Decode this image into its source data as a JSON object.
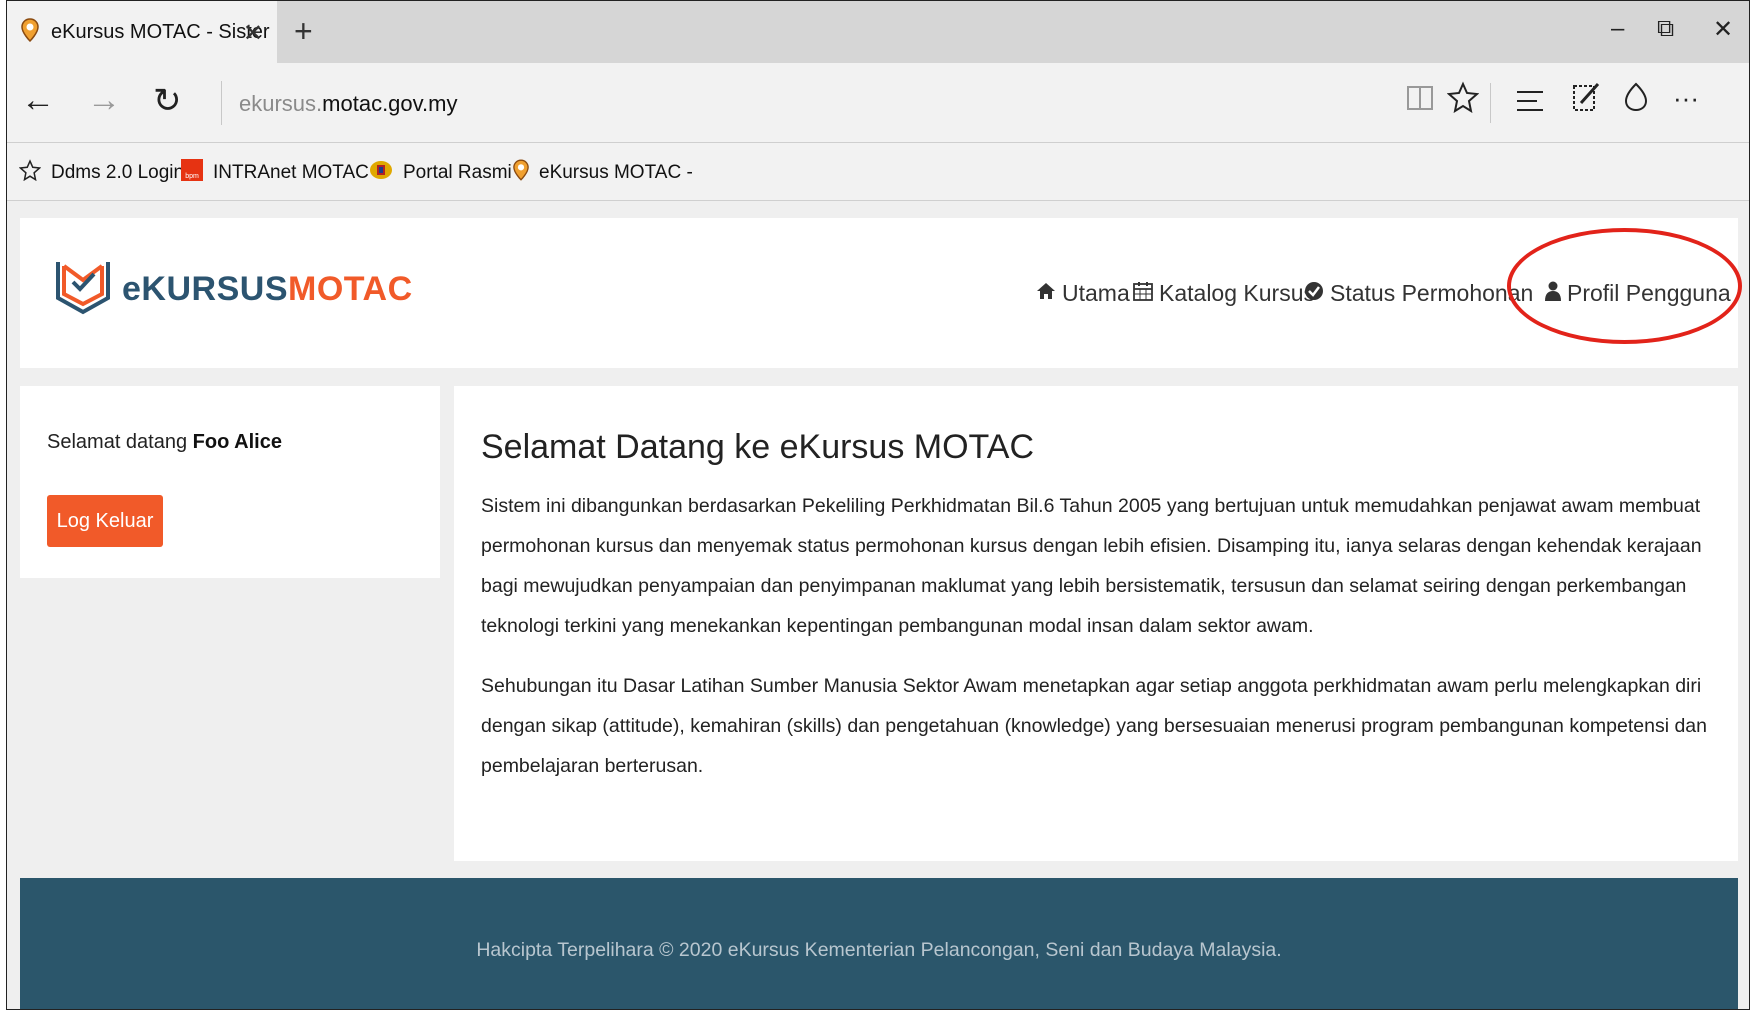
{
  "browser": {
    "tab_title": "eKursus MOTAC - Sister",
    "tab_close": "✕",
    "new_tab": "+",
    "window_controls": {
      "minimize": "–",
      "restore": "⧉",
      "close": "✕"
    },
    "nav": {
      "back": "←",
      "forward": "→",
      "refresh": "↻"
    },
    "url_subdomain": "ekursus.",
    "url_domain": "motac.gov.my",
    "toolbar_icons": [
      "reading-view-icon",
      "favorite-star-icon",
      "hub-icon",
      "web-note-icon",
      "share-icon",
      "more-icon"
    ],
    "more_label": "···",
    "favorites": [
      {
        "label": "Ddms 2.0 Login",
        "icon": "star-icon"
      },
      {
        "label": "INTRAnet MOTAC -",
        "icon": "bpm-icon"
      },
      {
        "label": "Portal Rasmi",
        "icon": "crest-icon"
      },
      {
        "label": "eKursus MOTAC -",
        "icon": "pin-icon"
      }
    ]
  },
  "site": {
    "logo": {
      "part1": "e",
      "part2": "KURSUS",
      "part3": "MOTAC"
    },
    "nav": [
      {
        "label": "Utama",
        "icon": "home-icon"
      },
      {
        "label": "Katalog Kursus",
        "icon": "calendar-icon"
      },
      {
        "label": "Status Permohonan",
        "icon": "check-circle-icon"
      },
      {
        "label": "Profil Pengguna",
        "icon": "user-icon"
      }
    ],
    "highlight_color": "#e2231a"
  },
  "sidebar": {
    "welcome_prefix": "Selamat datang",
    "user_name": "Foo Alice",
    "logout_label": "Log Keluar",
    "logout_color": "#f15a29"
  },
  "main": {
    "title": "Selamat Datang ke eKursus MOTAC",
    "paragraph1": "Sistem ini dibangunkan berdasarkan Pekeliling Perkhidmatan Bil.6 Tahun 2005 yang bertujuan untuk memudahkan penjawat awam membuat permohonan kursus dan menyemak status permohonan kursus dengan lebih efisien. Disamping itu, ianya selaras dengan kehendak kerajaan bagi mewujudkan penyampaian dan penyimpanan maklumat yang lebih bersistematik, tersusun dan selamat seiring dengan perkembangan teknologi terkini yang menekankan kepentingan pembangunan modal insan dalam sektor awam.",
    "paragraph2": "Sehubungan itu Dasar Latihan Sumber Manusia Sektor Awam menetapkan agar setiap anggota perkhidmatan awam perlu melengkapkan diri dengan sikap (attitude), kemahiran (skills) dan pengetahuan (knowledge) yang bersesuaian menerusi program pembangunan kompetensi dan pembelajaran berterusan."
  },
  "footer": {
    "text": "Hakcipta Terpelihara © 2020 eKursus Kementerian Pelancongan, Seni dan Budaya Malaysia.",
    "background": "#2b566b"
  }
}
